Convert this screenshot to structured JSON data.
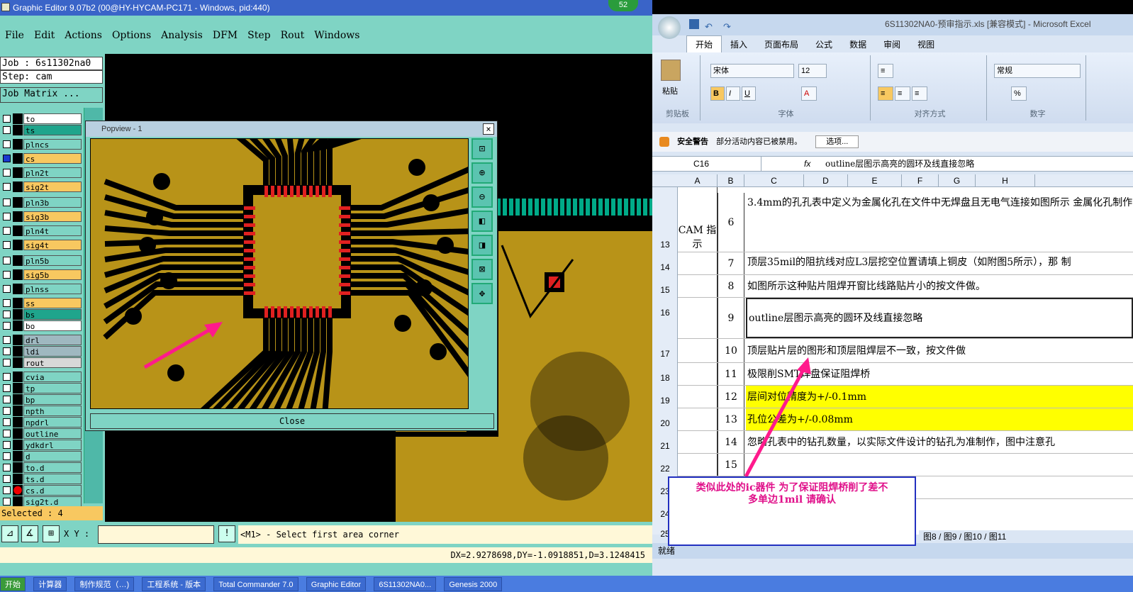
{
  "cam": {
    "title": "Graphic Editor 9.07b2 (00@HY-HYCAM-PC171 - Windows, pid:440)",
    "menu": [
      "File",
      "Edit",
      "Actions",
      "Options",
      "Analysis",
      "DFM",
      "Step",
      "Rout",
      "Windows"
    ],
    "job": "Job : 6s11302na0",
    "step": "Step: cam",
    "job_matrix": "Job Matrix ...",
    "layers": [
      {
        "name": "to",
        "color": "#ffffff"
      },
      {
        "name": "ts",
        "color": "#1fa58c"
      },
      {
        "name": "plncs",
        "color": "#7fd4c4"
      },
      {
        "name": "cs",
        "color": "#f8c860"
      },
      {
        "name": "pln2t",
        "color": "#7fd4c4"
      },
      {
        "name": "sig2t",
        "color": "#f8c860"
      },
      {
        "name": "pln3b",
        "color": "#7fd4c4"
      },
      {
        "name": "sig3b",
        "color": "#f8c860"
      },
      {
        "name": "pln4t",
        "color": "#7fd4c4"
      },
      {
        "name": "sig4t",
        "color": "#f8c860"
      },
      {
        "name": "pln5b",
        "color": "#7fd4c4"
      },
      {
        "name": "sig5b",
        "color": "#f8c860"
      },
      {
        "name": "plnss",
        "color": "#7fd4c4"
      },
      {
        "name": "ss",
        "color": "#f8c860"
      },
      {
        "name": "bs",
        "color": "#1fa58c"
      },
      {
        "name": "bo",
        "color": "#ffffff"
      },
      {
        "name": "drl",
        "color": "#9fb8c0"
      },
      {
        "name": "ldi",
        "color": "#9fb8c0"
      },
      {
        "name": "rout",
        "color": "#d8d8d8"
      },
      {
        "name": "cvia",
        "color": "#7fd4c4"
      },
      {
        "name": "tp",
        "color": "#7fd4c4"
      },
      {
        "name": "bp",
        "color": "#7fd4c4"
      },
      {
        "name": "npth",
        "color": "#7fd4c4"
      },
      {
        "name": "npdrl",
        "color": "#7fd4c4"
      },
      {
        "name": "outline",
        "color": "#7fd4c4"
      },
      {
        "name": "ydkdrl",
        "color": "#7fd4c4"
      },
      {
        "name": "d",
        "color": "#7fd4c4"
      },
      {
        "name": "to.d",
        "color": "#7fd4c4"
      },
      {
        "name": "ts.d",
        "color": "#7fd4c4"
      },
      {
        "name": "cs.d",
        "color": "#7fd4c4"
      },
      {
        "name": "sig2t.d",
        "color": "#7fd4c4"
      }
    ],
    "selected": "Selected : 4",
    "xy_label": "X Y :",
    "hint": "<M1> - Select first area corner",
    "status": "DX=2.9278698,DY=-1.0918851,D=3.1248415",
    "badge": "52"
  },
  "popview": {
    "title": "Popview - 1",
    "close_x": "×",
    "close_label": "Close",
    "tools": [
      "fit-icon",
      "zoom-in-icon",
      "zoom-out-icon",
      "pan-left-icon",
      "pan-right-icon",
      "zoom-area-icon",
      "center-icon"
    ]
  },
  "excel": {
    "title": "6S11302NA0-预审指示.xls [兼容模式] - Microsoft Excel",
    "tabs": [
      "开始",
      "插入",
      "页面布局",
      "公式",
      "数据",
      "审阅",
      "视图"
    ],
    "font": "宋体",
    "size": "12",
    "number_format": "常规",
    "groups": [
      "剪贴板",
      "字体",
      "对齐方式",
      "数字"
    ],
    "paste": "粘贴",
    "security_title": "安全警告",
    "security_msg": "部分活动内容已被禁用。",
    "security_btn": "选项...",
    "namebox": "C16",
    "fx": "fx",
    "formula": "outline层图示高亮的圆环及线直接忽略",
    "columns": [
      "A",
      "B",
      "C",
      "D",
      "E",
      "F",
      "G",
      "H"
    ],
    "row_numbers": [
      "13",
      "14",
      "15",
      "16",
      "17",
      "18",
      "19",
      "20",
      "21",
      "22",
      "23",
      "24",
      "25"
    ],
    "cam_label": "CAM 指示",
    "rows": [
      {
        "num": "6",
        "text": "3.4mm的孔孔表中定义为金属化孔在文件中无焊盘且无电气连接如图所示 金属化孔制作",
        "yellow": false
      },
      {
        "num": "7",
        "text": "顶层35mil的阻抗线对应L3层挖空位置请填上铜皮（如附图5所示），那 制",
        "yellow": false
      },
      {
        "num": "8",
        "text": "如图所示这种贴片阻焊开窗比线路贴片小的按文件做。",
        "yellow": false
      },
      {
        "num": "9",
        "text": "outline层图示高亮的圆环及线直接忽略",
        "yellow": false
      },
      {
        "num": "10",
        "text": "顶层贴片层的图形和顶层阻焊层不一致，按文件做",
        "yellow": false
      },
      {
        "num": "11",
        "text": "极限削SMT焊盘保证阻焊桥",
        "yellow": false
      },
      {
        "num": "12",
        "text": "层间对位精度为+/-0.1mm",
        "yellow": true
      },
      {
        "num": "13",
        "text": "孔位公差为+/-0.08mm",
        "yellow": true
      },
      {
        "num": "14",
        "text": "忽略孔表中的钻孔数量，以实际文件设计的钻孔为准制作，图中注意孔",
        "yellow": false
      },
      {
        "num": "15",
        "text": "",
        "yellow": false
      },
      {
        "num": "16",
        "text": "",
        "yellow": false
      }
    ],
    "sheets": [
      "图8",
      "图9",
      "图10",
      "图11"
    ],
    "status": "就绪"
  },
  "callout": {
    "line1": "类似此处的ic器件  为了保证阻焊桥削了差不",
    "line2": "多单边1mil 请确认"
  },
  "taskbar": [
    "开始",
    "计算器",
    "制作规范（…)",
    "工程系统 - 版本",
    "Total Commander 7.0",
    "Graphic Editor",
    "6S11302NA0...",
    "Genesis 2000"
  ]
}
